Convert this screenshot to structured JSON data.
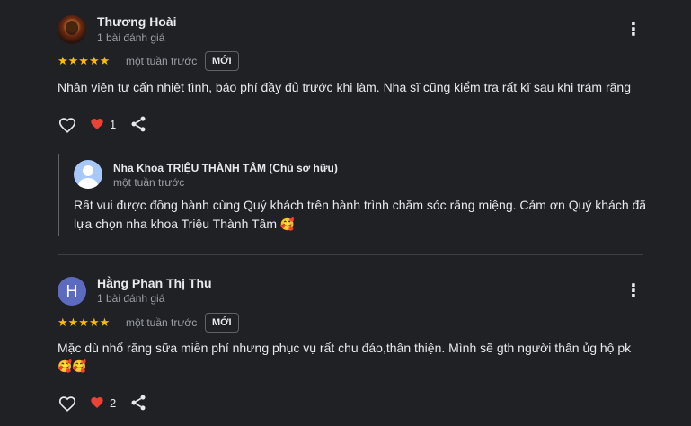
{
  "reviews": [
    {
      "author": "Thương Hoài",
      "review_count": "1 bài đánh giá",
      "stars": "★★★★★",
      "time": "một tuần trước",
      "badge": "MỚI",
      "text": "Nhân viên tư cấn nhiệt tình, báo phí đầy đủ trước khi làm. Nha sĩ cũng kiểm tra rất kĩ sau khi trám răng",
      "likes": "1",
      "avatar": "photo",
      "reply": {
        "owner": "Nha Khoa TRIỆU THÀNH TÂM (Chủ sở hữu)",
        "time": "một tuần trước",
        "text_line1": "Rất vui được đồng hành cùng Quý khách trên hành trình chăm sóc răng miệng. Cảm ơn Quý khách đã",
        "text_line2": "lựa chọn nha khoa Triệu Thành Tâm",
        "emoji": "🥰"
      }
    },
    {
      "author": "Hằng Phan Thị Thu",
      "initial": "H",
      "review_count": "1 bài đánh giá",
      "stars": "★★★★★",
      "time": "một tuần trước",
      "badge": "MỚI",
      "text": "Mặc dù nhổ răng sữa miễn phí nhưng phục vụ rất chu đáo,thân thiện. Mình sẽ gth người thân ủg hộ pk",
      "emoji": "🥰🥰",
      "likes": "2"
    }
  ],
  "icons": {
    "more": "more-vert-icon",
    "like": "heart-outline-icon",
    "liked": "heart-red-icon",
    "share": "share-icon"
  },
  "colors": {
    "star": "#fbbc04",
    "heart": "#ea4335",
    "background": "#202124"
  }
}
